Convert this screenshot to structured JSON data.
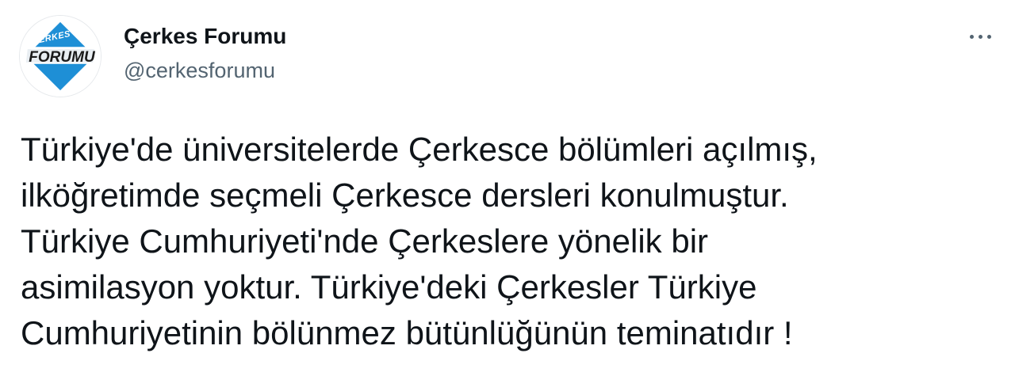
{
  "tweet": {
    "author": {
      "display_name": "Çerkes Forumu",
      "handle": "@cerkesforumu",
      "avatar": {
        "logo_top": "ÇERKES",
        "logo_main": "FORUMU",
        "colors": {
          "blue": "#1e8fd6",
          "dark": "#1a1a1a",
          "white": "#ffffff"
        }
      }
    },
    "more_icon": "more-horizontal-icon",
    "text_lines": [
      "Türkiye'de üniversitelerde Çerkesce bölümleri açılmış,",
      "ilköğretimde seçmeli Çerkesce dersleri konulmuştur.",
      "Türkiye Cumhuriyeti'nde Çerkeslere yönelik bir",
      "asimilasyon yoktur. Türkiye'deki Çerkesler Türkiye",
      "Cumhuriyetinin bölünmez bütünlüğünün teminatıdır !"
    ]
  }
}
